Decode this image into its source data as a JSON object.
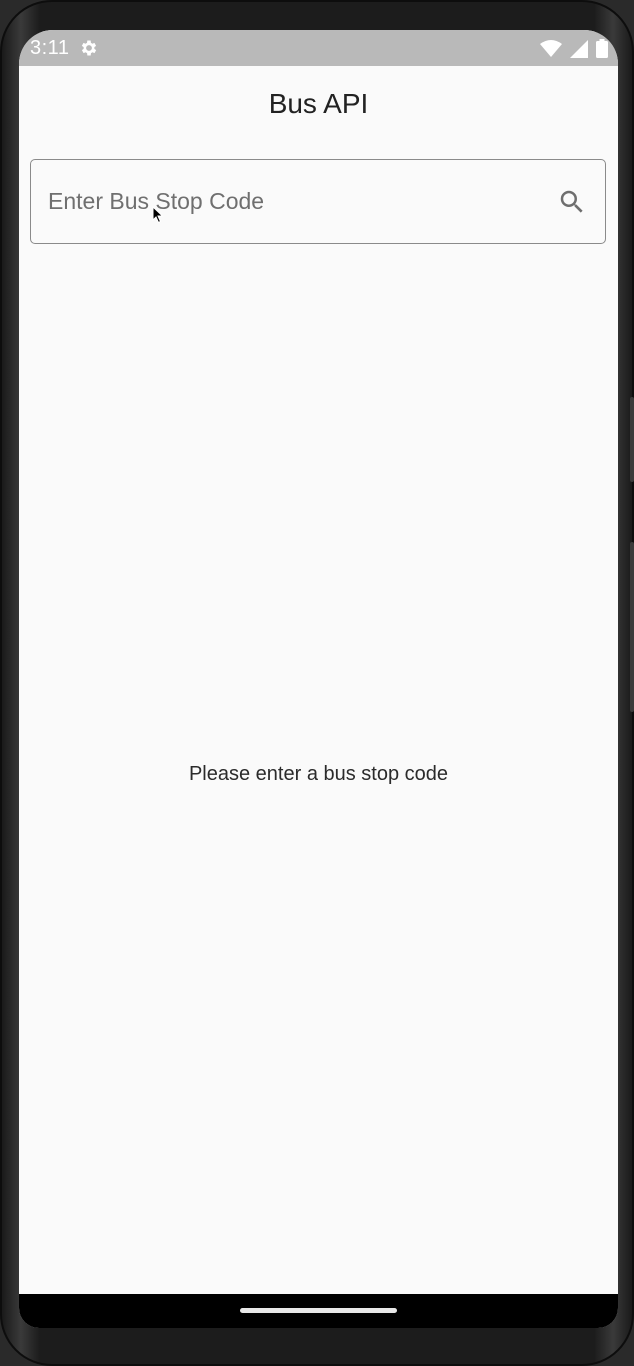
{
  "status_bar": {
    "time": "3:11",
    "icons": [
      "settings-gear-icon",
      "wifi-icon",
      "signal-icon",
      "battery-icon"
    ]
  },
  "app": {
    "title": "Bus API"
  },
  "search": {
    "placeholder": "Enter Bus Stop Code",
    "value": "",
    "icon": "search-icon"
  },
  "empty_state": {
    "message": "Please enter a bus stop code"
  },
  "colors": {
    "background": "#fafafa",
    "status_bar": "#b9b9b9",
    "text": "#222222",
    "border": "#8a8a8a"
  }
}
